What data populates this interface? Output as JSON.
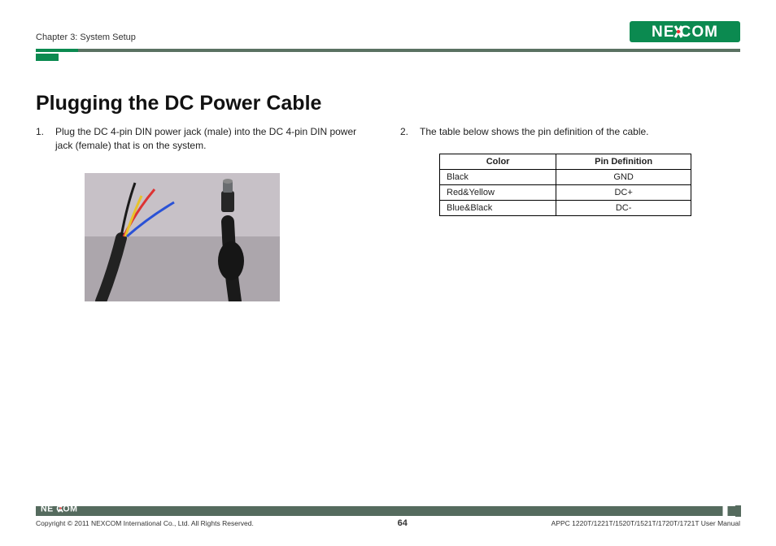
{
  "header": {
    "chapter": "Chapter 3: System Setup"
  },
  "title": "Plugging the DC Power Cable",
  "left": {
    "num": "1.",
    "text": "Plug the DC 4-pin DIN power jack (male) into the DC 4-pin DIN power jack (female) that is on the system."
  },
  "right": {
    "num": "2.",
    "text": "The table below shows the pin definition of the cable.",
    "table": {
      "h1": "Color",
      "h2": "Pin Definition",
      "rows": [
        {
          "c": "Black",
          "p": "GND"
        },
        {
          "c": "Red&Yellow",
          "p": "DC+"
        },
        {
          "c": "Blue&Black",
          "p": "DC-"
        }
      ]
    }
  },
  "footer": {
    "copyright": "Copyright © 2011 NEXCOM International Co., Ltd. All Rights Reserved.",
    "page": "64",
    "manual": "APPC 1220T/1221T/1520T/1521T/1720T/1721T User Manual"
  }
}
